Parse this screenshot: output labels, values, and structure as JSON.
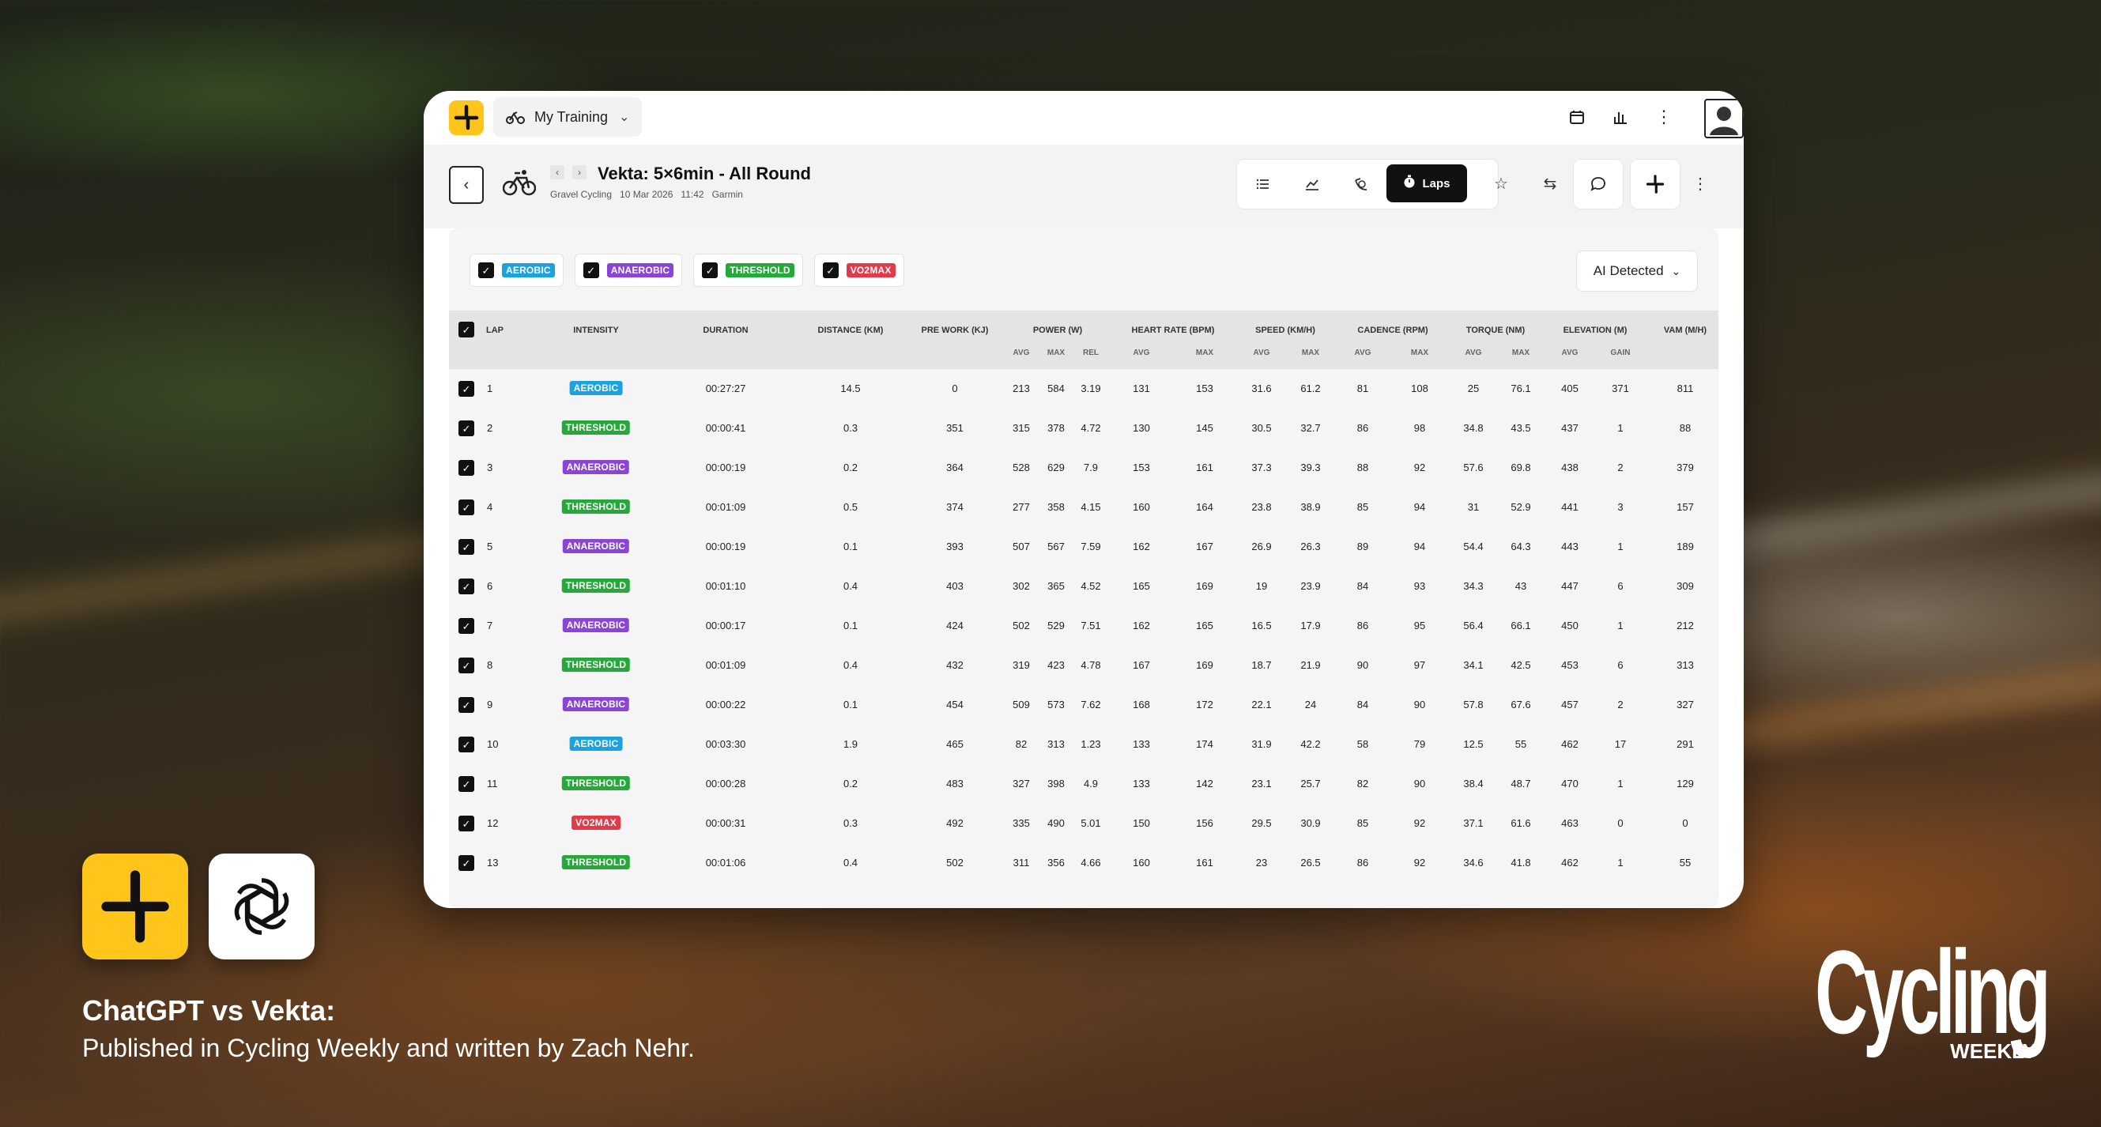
{
  "colors": {
    "accent": "#ffc51a",
    "aerobic": "#1aa3e0",
    "anaerobic": "#8b45d6",
    "threshold": "#26a83a",
    "vo2max": "#e23a48"
  },
  "topbar": {
    "training_label": "My Training",
    "icons": [
      "calendar-icon",
      "bar-chart-icon",
      "more-vertical-icon",
      "user-avatar"
    ]
  },
  "activity": {
    "title": "Vekta: 5×6min - All Round",
    "sport": "Gravel Cycling",
    "date": "10 Mar 2026",
    "time": "11:42",
    "device": "Garmin"
  },
  "toolbar": {
    "laps_label": "Laps",
    "icons": [
      "list-icon",
      "line-chart-icon",
      "power-curve-icon",
      "laps-icon",
      "star-icon",
      "swap-icon",
      "comment-icon",
      "vekta-icon",
      "more-vertical-icon"
    ]
  },
  "filters": [
    {
      "label": "AEROBIC",
      "color": "#1aa3e0"
    },
    {
      "label": "ANAEROBIC",
      "color": "#8b45d6"
    },
    {
      "label": "THRESHOLD",
      "color": "#26a83a"
    },
    {
      "label": "VO2MAX",
      "color": "#e23a48"
    }
  ],
  "ai_dropdown": {
    "label": "AI Detected"
  },
  "table": {
    "headers": {
      "lap": "LAP",
      "intensity": "INTENSITY",
      "duration": "DURATION",
      "distance": "DISTANCE (KM)",
      "prework": "PRE WORK (KJ)",
      "power": "POWER (W)",
      "hr": "HEART RATE (BPM)",
      "speed": "SPEED (KM/H)",
      "cadence": "CADENCE (RPM)",
      "torque": "TORQUE (NM)",
      "elevation": "ELEVATION (M)",
      "vam": "VAM (M/H)"
    },
    "subheaders": {
      "power": [
        "AVG",
        "MAX",
        "REL"
      ],
      "hr": [
        "AVG",
        "MAX"
      ],
      "speed": [
        "AVG",
        "MAX"
      ],
      "cadence": [
        "AVG",
        "MAX"
      ],
      "torque": [
        "AVG",
        "MAX"
      ],
      "elevation": [
        "AVG",
        "GAIN"
      ]
    },
    "rows": [
      {
        "lap": "1",
        "intensity": "AEROBIC",
        "duration": "00:27:27",
        "distance": "14.5",
        "prework": "0",
        "p_avg": "213",
        "p_max": "584",
        "p_rel": "3.19",
        "hr_avg": "131",
        "hr_max": "153",
        "s_avg": "31.6",
        "s_max": "61.2",
        "c_avg": "81",
        "c_max": "108",
        "t_avg": "25",
        "t_max": "76.1",
        "e_avg": "405",
        "e_gain": "371",
        "vam": "811"
      },
      {
        "lap": "2",
        "intensity": "THRESHOLD",
        "duration": "00:00:41",
        "distance": "0.3",
        "prework": "351",
        "p_avg": "315",
        "p_max": "378",
        "p_rel": "4.72",
        "hr_avg": "130",
        "hr_max": "145",
        "s_avg": "30.5",
        "s_max": "32.7",
        "c_avg": "86",
        "c_max": "98",
        "t_avg": "34.8",
        "t_max": "43.5",
        "e_avg": "437",
        "e_gain": "1",
        "vam": "88"
      },
      {
        "lap": "3",
        "intensity": "ANAEROBIC",
        "duration": "00:00:19",
        "distance": "0.2",
        "prework": "364",
        "p_avg": "528",
        "p_max": "629",
        "p_rel": "7.9",
        "hr_avg": "153",
        "hr_max": "161",
        "s_avg": "37.3",
        "s_max": "39.3",
        "c_avg": "88",
        "c_max": "92",
        "t_avg": "57.6",
        "t_max": "69.8",
        "e_avg": "438",
        "e_gain": "2",
        "vam": "379"
      },
      {
        "lap": "4",
        "intensity": "THRESHOLD",
        "duration": "00:01:09",
        "distance": "0.5",
        "prework": "374",
        "p_avg": "277",
        "p_max": "358",
        "p_rel": "4.15",
        "hr_avg": "160",
        "hr_max": "164",
        "s_avg": "23.8",
        "s_max": "38.9",
        "c_avg": "85",
        "c_max": "94",
        "t_avg": "31",
        "t_max": "52.9",
        "e_avg": "441",
        "e_gain": "3",
        "vam": "157"
      },
      {
        "lap": "5",
        "intensity": "ANAEROBIC",
        "duration": "00:00:19",
        "distance": "0.1",
        "prework": "393",
        "p_avg": "507",
        "p_max": "567",
        "p_rel": "7.59",
        "hr_avg": "162",
        "hr_max": "167",
        "s_avg": "26.9",
        "s_max": "26.3",
        "c_avg": "89",
        "c_max": "94",
        "t_avg": "54.4",
        "t_max": "64.3",
        "e_avg": "443",
        "e_gain": "1",
        "vam": "189"
      },
      {
        "lap": "6",
        "intensity": "THRESHOLD",
        "duration": "00:01:10",
        "distance": "0.4",
        "prework": "403",
        "p_avg": "302",
        "p_max": "365",
        "p_rel": "4.52",
        "hr_avg": "165",
        "hr_max": "169",
        "s_avg": "19",
        "s_max": "23.9",
        "c_avg": "84",
        "c_max": "93",
        "t_avg": "34.3",
        "t_max": "43",
        "e_avg": "447",
        "e_gain": "6",
        "vam": "309"
      },
      {
        "lap": "7",
        "intensity": "ANAEROBIC",
        "duration": "00:00:17",
        "distance": "0.1",
        "prework": "424",
        "p_avg": "502",
        "p_max": "529",
        "p_rel": "7.51",
        "hr_avg": "162",
        "hr_max": "165",
        "s_avg": "16.5",
        "s_max": "17.9",
        "c_avg": "86",
        "c_max": "95",
        "t_avg": "56.4",
        "t_max": "66.1",
        "e_avg": "450",
        "e_gain": "1",
        "vam": "212"
      },
      {
        "lap": "8",
        "intensity": "THRESHOLD",
        "duration": "00:01:09",
        "distance": "0.4",
        "prework": "432",
        "p_avg": "319",
        "p_max": "423",
        "p_rel": "4.78",
        "hr_avg": "167",
        "hr_max": "169",
        "s_avg": "18.7",
        "s_max": "21.9",
        "c_avg": "90",
        "c_max": "97",
        "t_avg": "34.1",
        "t_max": "42.5",
        "e_avg": "453",
        "e_gain": "6",
        "vam": "313"
      },
      {
        "lap": "9",
        "intensity": "ANAEROBIC",
        "duration": "00:00:22",
        "distance": "0.1",
        "prework": "454",
        "p_avg": "509",
        "p_max": "573",
        "p_rel": "7.62",
        "hr_avg": "168",
        "hr_max": "172",
        "s_avg": "22.1",
        "s_max": "24",
        "c_avg": "84",
        "c_max": "90",
        "t_avg": "57.8",
        "t_max": "67.6",
        "e_avg": "457",
        "e_gain": "2",
        "vam": "327"
      },
      {
        "lap": "10",
        "intensity": "AEROBIC",
        "duration": "00:03:30",
        "distance": "1.9",
        "prework": "465",
        "p_avg": "82",
        "p_max": "313",
        "p_rel": "1.23",
        "hr_avg": "133",
        "hr_max": "174",
        "s_avg": "31.9",
        "s_max": "42.2",
        "c_avg": "58",
        "c_max": "79",
        "t_avg": "12.5",
        "t_max": "55",
        "e_avg": "462",
        "e_gain": "17",
        "vam": "291"
      },
      {
        "lap": "11",
        "intensity": "THRESHOLD",
        "duration": "00:00:28",
        "distance": "0.2",
        "prework": "483",
        "p_avg": "327",
        "p_max": "398",
        "p_rel": "4.9",
        "hr_avg": "133",
        "hr_max": "142",
        "s_avg": "23.1",
        "s_max": "25.7",
        "c_avg": "82",
        "c_max": "90",
        "t_avg": "38.4",
        "t_max": "48.7",
        "e_avg": "470",
        "e_gain": "1",
        "vam": "129"
      },
      {
        "lap": "12",
        "intensity": "VO2MAX",
        "duration": "00:00:31",
        "distance": "0.3",
        "prework": "492",
        "p_avg": "335",
        "p_max": "490",
        "p_rel": "5.01",
        "hr_avg": "150",
        "hr_max": "156",
        "s_avg": "29.5",
        "s_max": "30.9",
        "c_avg": "85",
        "c_max": "92",
        "t_avg": "37.1",
        "t_max": "61.6",
        "e_avg": "463",
        "e_gain": "0",
        "vam": "0"
      },
      {
        "lap": "13",
        "intensity": "THRESHOLD",
        "duration": "00:01:06",
        "distance": "0.4",
        "prework": "502",
        "p_avg": "311",
        "p_max": "356",
        "p_rel": "4.66",
        "hr_avg": "160",
        "hr_max": "161",
        "s_avg": "23",
        "s_max": "26.5",
        "c_avg": "86",
        "c_max": "92",
        "t_avg": "34.6",
        "t_max": "41.8",
        "e_avg": "462",
        "e_gain": "1",
        "vam": "55"
      }
    ]
  },
  "caption": {
    "title": "ChatGPT vs Vekta:",
    "subtitle": "Published in Cycling Weekly and written by  Zach Nehr."
  },
  "publication": {
    "name": "Cycling",
    "sub": "WEEKLY"
  }
}
